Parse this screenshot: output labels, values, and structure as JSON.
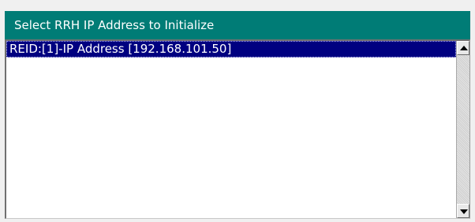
{
  "dialog": {
    "title": "Select RRH IP Address to Initialize"
  },
  "list": {
    "items": [
      {
        "label": "REID:[1]-IP Address [192.168.101.50]",
        "selected": true
      }
    ]
  },
  "scrollbar": {
    "up_icon": "arrow-up-icon",
    "down_icon": "arrow-down-icon"
  },
  "colors": {
    "title_bar": "#007c76",
    "selection": "#000080"
  }
}
